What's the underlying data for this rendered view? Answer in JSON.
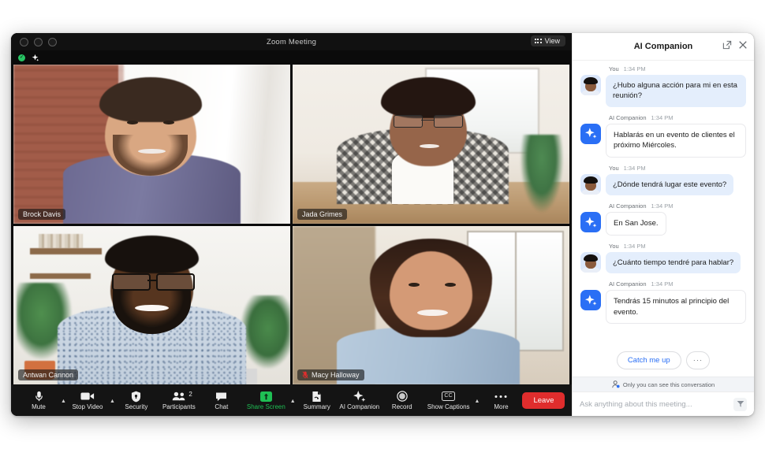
{
  "window": {
    "title": "Zoom Meeting",
    "view_button": "View",
    "traffic_lights": [
      "close",
      "minimize",
      "maximize"
    ]
  },
  "video_grid": {
    "tiles": [
      {
        "name": "Brock Davis",
        "muted": false,
        "active_speaker": false
      },
      {
        "name": "Jada Grimes",
        "muted": false,
        "active_speaker": false
      },
      {
        "name": "Antwan Cannon",
        "muted": false,
        "active_speaker": true
      },
      {
        "name": "Macy Halloway",
        "muted": true,
        "active_speaker": false
      }
    ]
  },
  "toolbar": {
    "items": [
      {
        "label": "Mute",
        "icon": "microphone-icon",
        "caret": true,
        "accent": false
      },
      {
        "label": "Stop Video",
        "icon": "video-camera-icon",
        "caret": true,
        "accent": false
      },
      {
        "label": "Security",
        "icon": "shield-icon",
        "caret": false,
        "accent": false
      },
      {
        "label": "Participants",
        "icon": "participants-icon",
        "caret": false,
        "accent": false,
        "badge": "2"
      },
      {
        "label": "Chat",
        "icon": "chat-bubble-icon",
        "caret": false,
        "accent": false
      },
      {
        "label": "Share Screen",
        "icon": "share-screen-icon",
        "caret": true,
        "accent": true
      },
      {
        "label": "Summary",
        "icon": "summary-doc-icon",
        "caret": false,
        "accent": false
      },
      {
        "label": "AI Companion",
        "icon": "sparkle-icon",
        "caret": false,
        "accent": false
      },
      {
        "label": "Record",
        "icon": "record-circle-icon",
        "caret": false,
        "accent": false
      },
      {
        "label": "Show Captions",
        "icon": "cc-icon",
        "caret": true,
        "accent": false
      },
      {
        "label": "More",
        "icon": "ellipsis-icon",
        "caret": false,
        "accent": false
      }
    ],
    "leave_label": "Leave"
  },
  "ai_panel": {
    "title": "AI Companion",
    "popout_label": "Pop out",
    "close_label": "Close",
    "messages": [
      {
        "author": "You",
        "time": "1:34 PM",
        "side": "user",
        "text": "¿Hubo alguna acción para mi en esta reunión?"
      },
      {
        "author": "AI Companion",
        "time": "1:34 PM",
        "side": "ai",
        "text": "Hablarás en un evento de clientes el próximo Miércoles."
      },
      {
        "author": "You",
        "time": "1:34 PM",
        "side": "user",
        "text": "¿Dónde tendrá lugar este evento?"
      },
      {
        "author": "AI Companion",
        "time": "1:34 PM",
        "side": "ai",
        "text": "En San Jose."
      },
      {
        "author": "You",
        "time": "1:34 PM",
        "side": "user",
        "text": "¿Cuánto tiempo tendré para hablar?"
      },
      {
        "author": "AI Companion",
        "time": "1:34 PM",
        "side": "ai",
        "text": "Tendrás 15 minutos al principio del evento."
      }
    ],
    "quick_actions": {
      "catch_me_up": "Catch me up",
      "more": "···"
    },
    "privacy_note": "Only you can see this conversation",
    "composer_placeholder": "Ask anything about this meeting..."
  },
  "colors": {
    "accent_blue": "#2a6ff5",
    "active_speaker_green": "#27c463",
    "share_green": "#1fbf54",
    "leave_red": "#e02d2d",
    "user_bubble": "#e4eefc"
  }
}
